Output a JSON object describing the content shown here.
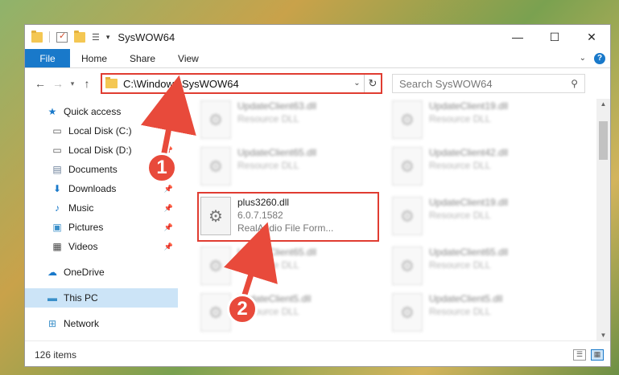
{
  "window": {
    "title": "SysWOW64",
    "controls": {
      "minimize": "—",
      "maximize": "☐",
      "close": "✕"
    }
  },
  "ribbon": {
    "tabs": [
      "File",
      "Home",
      "Share",
      "View"
    ]
  },
  "nav": {
    "address": "C:\\Windows\\SysWOW64",
    "search_placeholder": "Search SysWOW64"
  },
  "sidebar": {
    "items": [
      {
        "label": "Quick access",
        "icon": "star-icon"
      },
      {
        "label": "Local Disk (C:)",
        "icon": "drive-icon"
      },
      {
        "label": "Local Disk (D:)",
        "icon": "drive-icon"
      },
      {
        "label": "Documents",
        "icon": "documents-icon"
      },
      {
        "label": "Downloads",
        "icon": "downloads-icon"
      },
      {
        "label": "Music",
        "icon": "music-icon"
      },
      {
        "label": "Pictures",
        "icon": "pictures-icon"
      },
      {
        "label": "Videos",
        "icon": "videos-icon"
      },
      {
        "label": "OneDrive",
        "icon": "cloud-icon"
      },
      {
        "label": "This PC",
        "icon": "computer-icon"
      },
      {
        "label": "Network",
        "icon": "network-icon"
      }
    ]
  },
  "files": {
    "featured": {
      "name": "plus3260.dll",
      "version": "6.0.7.1582",
      "description": "RealAudio File Form..."
    },
    "blurred": [
      {
        "name": "UpdateClient63.dll",
        "type": "Resource DLL"
      },
      {
        "name": "UpdateClient19.dll",
        "type": "Resource DLL"
      },
      {
        "name": "UpdateClient65.dll",
        "type": "Resource DLL"
      },
      {
        "name": "UpdateClient42.dll",
        "type": "Resource DLL"
      },
      {
        "name": "UpdateClient19.dll",
        "type": "Resource DLL"
      },
      {
        "name": "UpdateClient65.dll",
        "type": "Resource DLL"
      },
      {
        "name": "UpdateClient65.dll",
        "type": "Resource DLL"
      },
      {
        "name": "UpdateClient5.dll",
        "type": "Resource DLL"
      },
      {
        "name": "UpdateClient5.dll",
        "type": "Resource DLL"
      }
    ]
  },
  "status": {
    "item_count": "126 items"
  },
  "annotations": {
    "step1": "1",
    "step2": "2"
  },
  "colors": {
    "accent": "#1979ca",
    "highlight": "#e03c31",
    "badge": "#e84a3b"
  }
}
